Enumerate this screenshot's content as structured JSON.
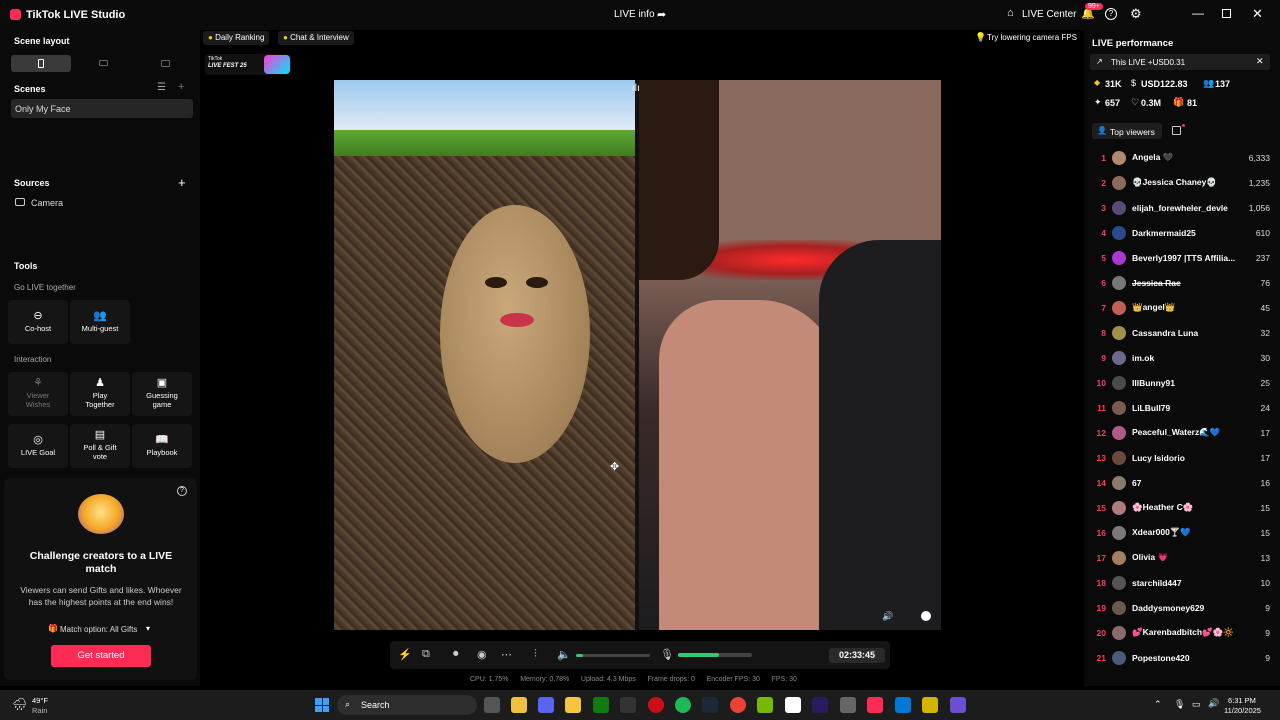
{
  "app": {
    "title": "TikTok LIVE Studio",
    "live_info": "LIVE info",
    "live_center": "LIVE Center",
    "notif_badge": "99+"
  },
  "left": {
    "scene_layout": "Scene layout",
    "scenes_title": "Scenes",
    "scene_item": "Only My Face",
    "sources_title": "Sources",
    "source_item": "Camera",
    "tools_title": "Tools",
    "go_live_together": "Go LIVE together",
    "cohost": "Co-host",
    "multiguest": "Multi-guest",
    "interaction": "Interaction",
    "viewer_wishes_1": "Viewer",
    "viewer_wishes_2": "Wishes",
    "play_together_1": "Play",
    "play_together_2": "Together",
    "guessing_1": "Guessing",
    "guessing_2": "game",
    "live_goal": "LIVE Goal",
    "poll_1": "Poll & Gift",
    "poll_2": "vote",
    "playbook": "Playbook",
    "challenge_title": "Challenge creators to a LIVE match",
    "challenge_desc": "Viewers can send Gifts and likes. Whoever has the highest points at the end wins!",
    "match_option": "Match option: All Gifts",
    "get_started": "Get started"
  },
  "top": {
    "daily_ranking": "Daily Ranking",
    "chat_interview": "Chat & Interview",
    "fps_tip": "Try lowering camera FPS",
    "fest_1": "TikTok",
    "fest_2": "LIVE FEST 25"
  },
  "controls": {
    "timer": "02:33:45",
    "mic_level": 0.55,
    "vol_level": 0.1
  },
  "status": {
    "cpu": "CPU:  1.75%",
    "memory": "Memory:  0.78%",
    "upload": "Upload:  4.3 Mbps",
    "frame_drops": "Frame drops:  0",
    "encoder_fps": "Encoder FPS:  30",
    "fps": "FPS:  30"
  },
  "right": {
    "title": "LIVE performance",
    "this_live": "This LIVE +USD0.31",
    "stat_1": "31K",
    "stat_2": "USD122.83",
    "stat_3": "137",
    "stat_4": "657",
    "stat_5": "0.3M",
    "stat_6": "81",
    "top_viewers": "Top viewers",
    "viewers": [
      {
        "rank": "1",
        "name": "Angela 🖤",
        "score": "6,333"
      },
      {
        "rank": "2",
        "name": "💀Jessica Chaney💀",
        "score": "1,235"
      },
      {
        "rank": "3",
        "name": "elijah_forewheler_devle",
        "score": "1,056"
      },
      {
        "rank": "4",
        "name": "Darkmermaid25",
        "score": "610"
      },
      {
        "rank": "5",
        "name": "Beverly1997 |TTS Affilia...",
        "score": "237"
      },
      {
        "rank": "6",
        "name": "Jessica Rae",
        "score": "76"
      },
      {
        "rank": "7",
        "name": "👑angel👑",
        "score": "45"
      },
      {
        "rank": "8",
        "name": "Cassandra Luna",
        "score": "32"
      },
      {
        "rank": "9",
        "name": "im.ok",
        "score": "30"
      },
      {
        "rank": "10",
        "name": "IllBunny91",
        "score": "25"
      },
      {
        "rank": "11",
        "name": "LiLBull79",
        "score": "24"
      },
      {
        "rank": "12",
        "name": "Peaceful_Waterz🌊💙",
        "score": "17"
      },
      {
        "rank": "13",
        "name": "Lucy Isidorio",
        "score": "17"
      },
      {
        "rank": "14",
        "name": "67",
        "score": "16"
      },
      {
        "rank": "15",
        "name": "🌸Heather C🌸",
        "score": "15"
      },
      {
        "rank": "16",
        "name": "Xdear000🍸💙",
        "score": "15"
      },
      {
        "rank": "17",
        "name": "Olivia 💗",
        "score": "13"
      },
      {
        "rank": "18",
        "name": "starchild447",
        "score": "10"
      },
      {
        "rank": "19",
        "name": "Daddysmoney629",
        "score": "9"
      },
      {
        "rank": "20",
        "name": "💕Karenbadbitch💕🌸🔆",
        "score": "9"
      },
      {
        "rank": "21",
        "name": "Popestone420",
        "score": "9"
      }
    ]
  },
  "taskbar": {
    "weather_temp": "49°F",
    "weather_desc": "Rain",
    "search": "Search",
    "time": "6:31 PM",
    "date": "11/20/2025"
  }
}
